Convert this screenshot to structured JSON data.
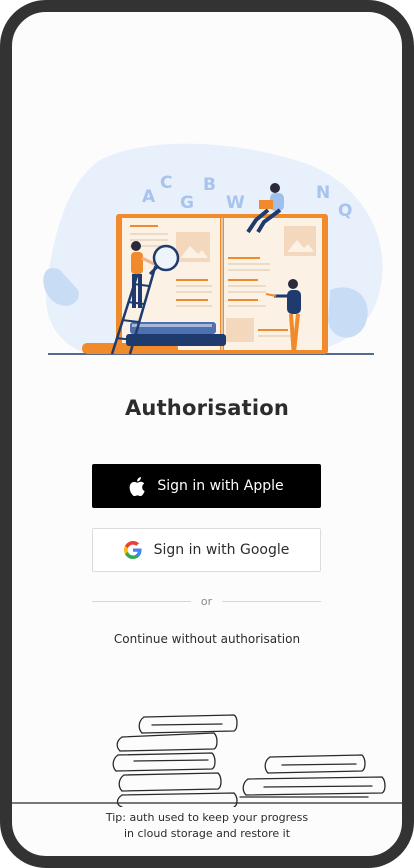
{
  "auth": {
    "title": "Authorisation",
    "apple_button_label": "Sign in with Apple",
    "google_button_label": "Sign in with Google",
    "divider_text": "or",
    "continue_label": "Continue without authorisation"
  },
  "tip": {
    "line1": "Tip: auth used to keep your progress",
    "line2": "in cloud storage and restore it"
  },
  "illustration": {
    "letters": [
      "A",
      "C",
      "G",
      "B",
      "W",
      "N",
      "Q"
    ]
  },
  "colors": {
    "frame": "#333333",
    "accent_orange": "#f08a2b",
    "accent_blue": "#1f3a6d",
    "light_blue": "#e7f0fb",
    "apple_button_bg": "#000000"
  },
  "icons": {
    "apple": "apple-icon",
    "google": "google-icon"
  }
}
